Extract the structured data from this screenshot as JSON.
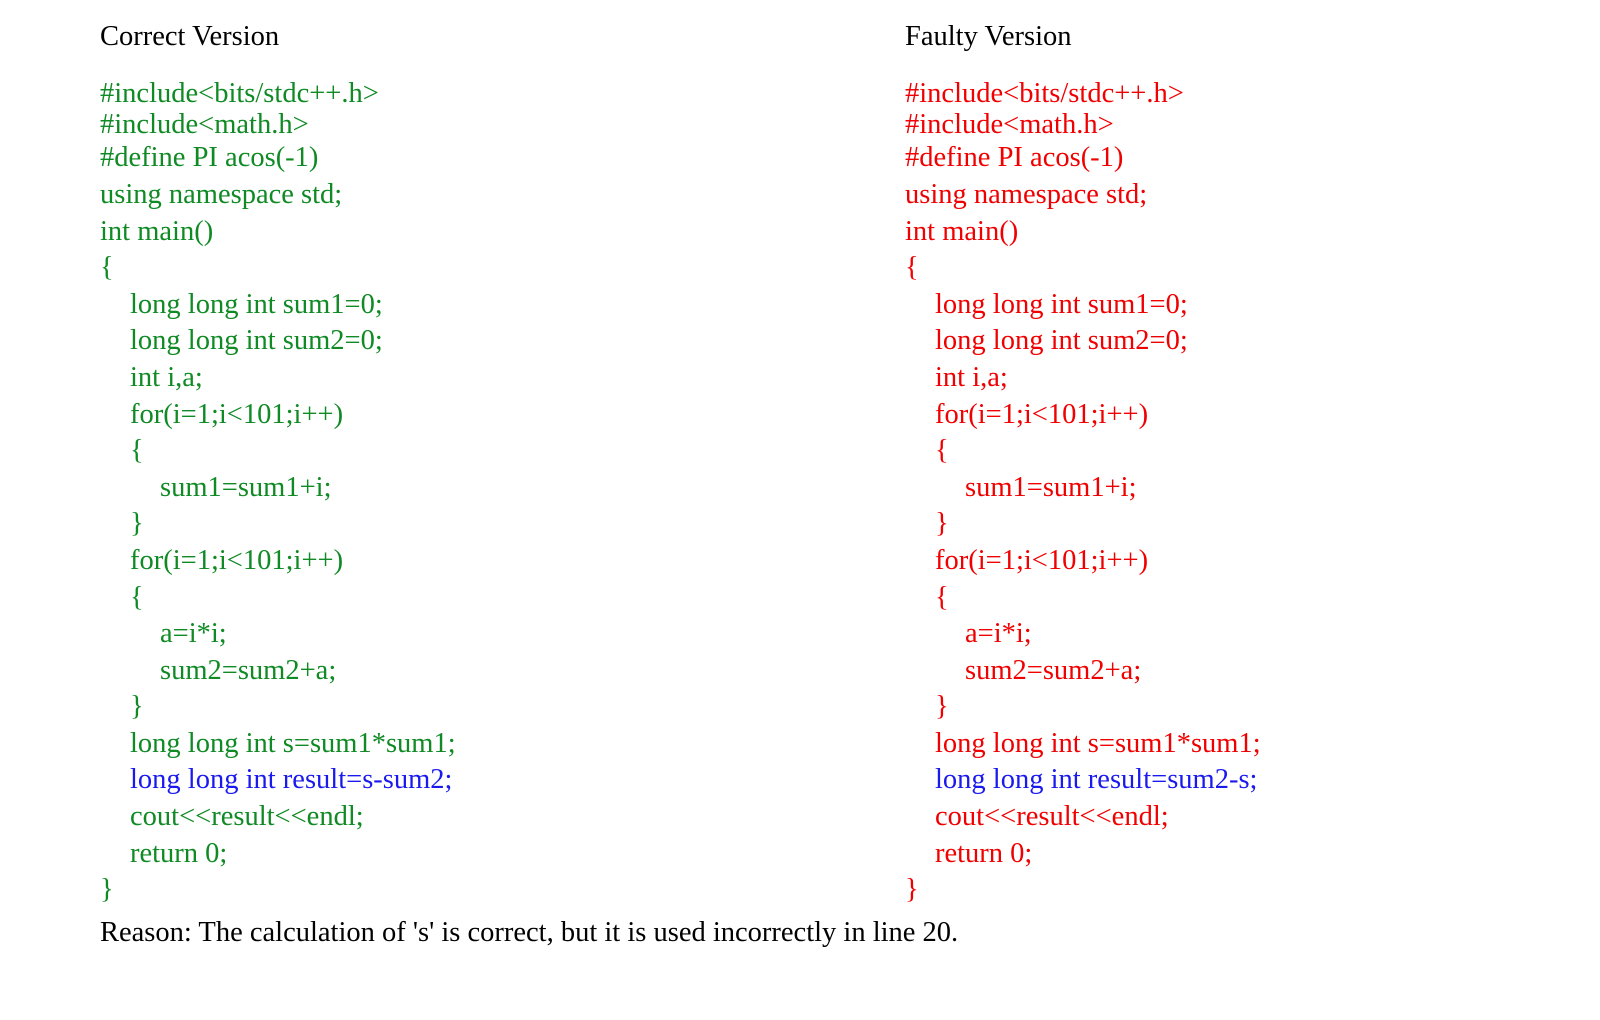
{
  "colors": {
    "correct_code": "#0f8a24",
    "faulty_code": "#f00000",
    "highlight_line": "#1a1aee",
    "text": "#000000",
    "background": "#ffffff"
  },
  "correct": {
    "title": "Correct Version",
    "lines": [
      {
        "text": "#include<bits/stdc++.h>",
        "indent": 0,
        "highlight": false,
        "tight": true
      },
      {
        "text": "#include<math.h>",
        "indent": 0,
        "highlight": false,
        "tight": true
      },
      {
        "text": "#define PI acos(-1)",
        "indent": 0,
        "highlight": false,
        "tight": false
      },
      {
        "text": "using namespace std;",
        "indent": 0,
        "highlight": false,
        "tight": false
      },
      {
        "text": "int main()",
        "indent": 0,
        "highlight": false,
        "tight": false
      },
      {
        "text": "{",
        "indent": 0,
        "highlight": false,
        "tight": false
      },
      {
        "text": "long long int sum1=0;",
        "indent": 1,
        "highlight": false,
        "tight": false
      },
      {
        "text": "long long int sum2=0;",
        "indent": 1,
        "highlight": false,
        "tight": false
      },
      {
        "text": "int i,a;",
        "indent": 1,
        "highlight": false,
        "tight": false
      },
      {
        "text": "for(i=1;i<101;i++)",
        "indent": 1,
        "highlight": false,
        "tight": false
      },
      {
        "text": "{",
        "indent": 1,
        "highlight": false,
        "tight": false
      },
      {
        "text": "sum1=sum1+i;",
        "indent": 2,
        "highlight": false,
        "tight": false
      },
      {
        "text": "}",
        "indent": 1,
        "highlight": false,
        "tight": false
      },
      {
        "text": "for(i=1;i<101;i++)",
        "indent": 1,
        "highlight": false,
        "tight": false
      },
      {
        "text": "{",
        "indent": 1,
        "highlight": false,
        "tight": false
      },
      {
        "text": "a=i*i;",
        "indent": 2,
        "highlight": false,
        "tight": false
      },
      {
        "text": "sum2=sum2+a;",
        "indent": 2,
        "highlight": false,
        "tight": false
      },
      {
        "text": "}",
        "indent": 1,
        "highlight": false,
        "tight": false
      },
      {
        "text": "long long int s=sum1*sum1;",
        "indent": 1,
        "highlight": false,
        "tight": false
      },
      {
        "text": "long long int result=s-sum2;",
        "indent": 1,
        "highlight": true,
        "tight": false
      },
      {
        "text": "cout<<result<<endl;",
        "indent": 1,
        "highlight": false,
        "tight": false
      },
      {
        "text": "return 0;",
        "indent": 1,
        "highlight": false,
        "tight": false
      },
      {
        "text": "}",
        "indent": 0,
        "highlight": false,
        "tight": false
      }
    ]
  },
  "faulty": {
    "title": "Faulty Version",
    "lines": [
      {
        "text": "#include<bits/stdc++.h>",
        "indent": 0,
        "highlight": false,
        "tight": true
      },
      {
        "text": "#include<math.h>",
        "indent": 0,
        "highlight": false,
        "tight": true
      },
      {
        "text": "#define PI acos(-1)",
        "indent": 0,
        "highlight": false,
        "tight": false
      },
      {
        "text": "using namespace std;",
        "indent": 0,
        "highlight": false,
        "tight": false
      },
      {
        "text": "int main()",
        "indent": 0,
        "highlight": false,
        "tight": false
      },
      {
        "text": "{",
        "indent": 0,
        "highlight": false,
        "tight": false
      },
      {
        "text": "long long int sum1=0;",
        "indent": 1,
        "highlight": false,
        "tight": false
      },
      {
        "text": "long long int sum2=0;",
        "indent": 1,
        "highlight": false,
        "tight": false
      },
      {
        "text": "int i,a;",
        "indent": 1,
        "highlight": false,
        "tight": false
      },
      {
        "text": "for(i=1;i<101;i++)",
        "indent": 1,
        "highlight": false,
        "tight": false
      },
      {
        "text": "{",
        "indent": 1,
        "highlight": false,
        "tight": false
      },
      {
        "text": "sum1=sum1+i;",
        "indent": 2,
        "highlight": false,
        "tight": false
      },
      {
        "text": "}",
        "indent": 1,
        "highlight": false,
        "tight": false
      },
      {
        "text": "for(i=1;i<101;i++)",
        "indent": 1,
        "highlight": false,
        "tight": false
      },
      {
        "text": "{",
        "indent": 1,
        "highlight": false,
        "tight": false
      },
      {
        "text": "a=i*i;",
        "indent": 2,
        "highlight": false,
        "tight": false
      },
      {
        "text": "sum2=sum2+a;",
        "indent": 2,
        "highlight": false,
        "tight": false
      },
      {
        "text": "}",
        "indent": 1,
        "highlight": false,
        "tight": false
      },
      {
        "text": "long long int s=sum1*sum1;",
        "indent": 1,
        "highlight": false,
        "tight": false
      },
      {
        "text": "long long int result=sum2-s;",
        "indent": 1,
        "highlight": true,
        "tight": false
      },
      {
        "text": "cout<<result<<endl;",
        "indent": 1,
        "highlight": false,
        "tight": false
      },
      {
        "text": "return 0;",
        "indent": 1,
        "highlight": false,
        "tight": false
      },
      {
        "text": "}",
        "indent": 0,
        "highlight": false,
        "tight": false
      }
    ]
  },
  "reason": "Reason: The calculation of 's' is correct, but it is used incorrectly in line 20."
}
